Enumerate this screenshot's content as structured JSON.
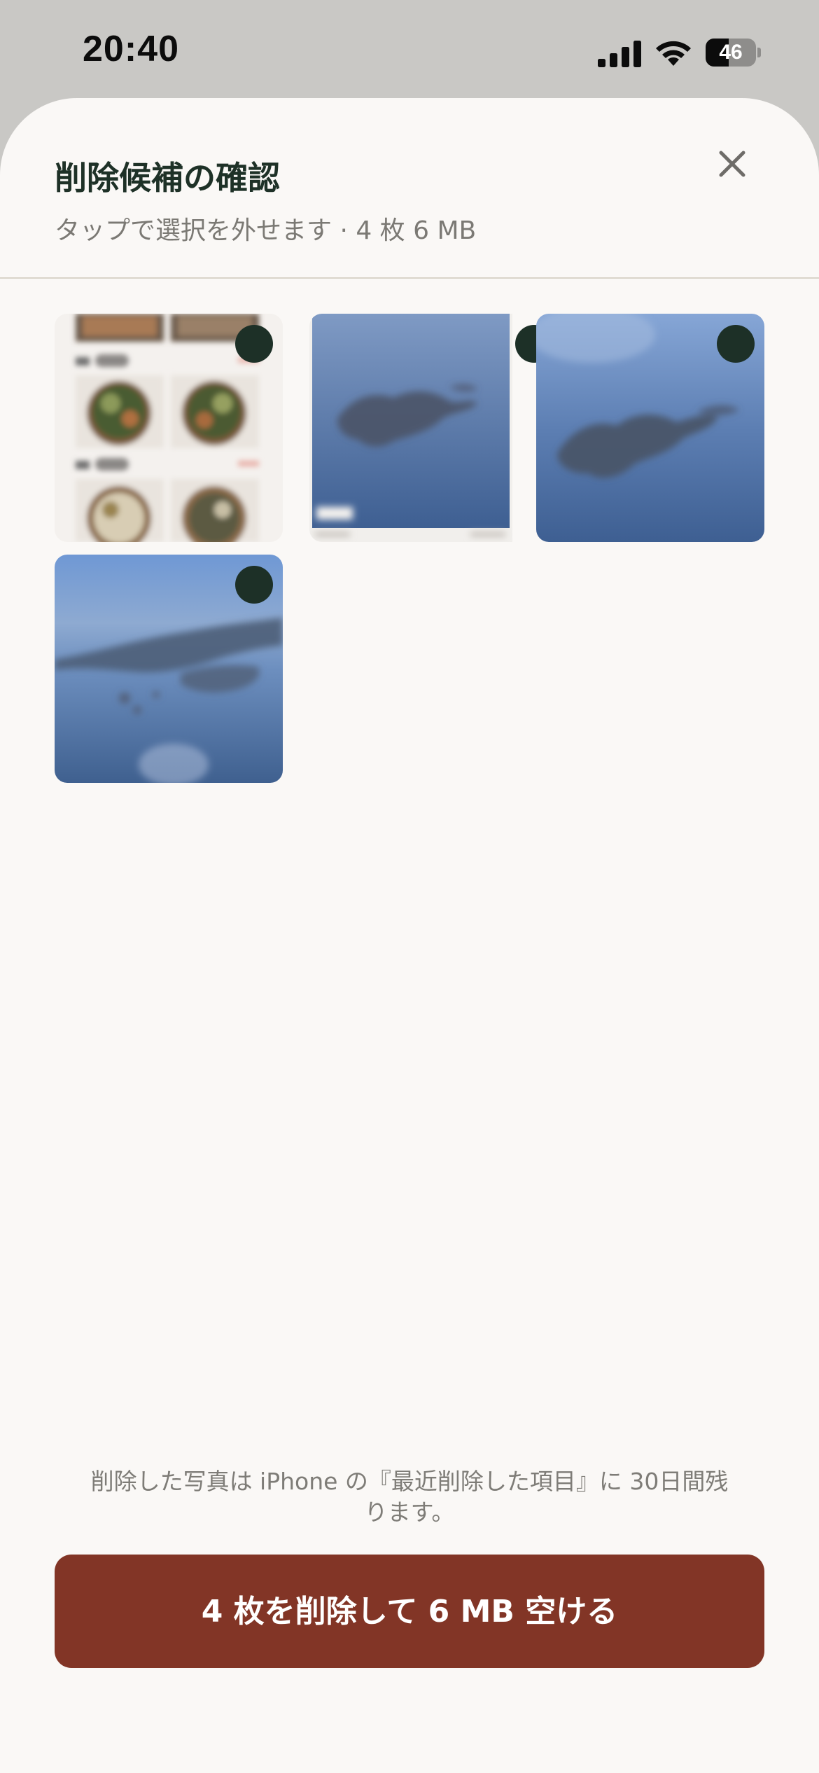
{
  "status_bar": {
    "time": "20:40",
    "battery": "46",
    "battery_level": 0.46
  },
  "header": {
    "title": "削除候補の確認",
    "subtitle": "タップで選択を外せます · 4 枚 6 MB",
    "close_icon": "close-icon"
  },
  "photos": [
    {
      "subject": "food-menu-screenshot",
      "selected": true
    },
    {
      "subject": "aerial-island-screenshot",
      "selected": true
    },
    {
      "subject": "aerial-island-photo",
      "selected": true
    },
    {
      "subject": "aerial-coastline-photo",
      "selected": true
    }
  ],
  "footer": {
    "note": "削除した写真は iPhone の『最近削除した項目』に 30日間残ります。",
    "delete_label": "4 枚を削除して 6 MB 空ける"
  },
  "colors": {
    "accent": "#823526",
    "title": "#1e3127",
    "selection_dot": "#1d3027",
    "background": "#faf8f6"
  }
}
